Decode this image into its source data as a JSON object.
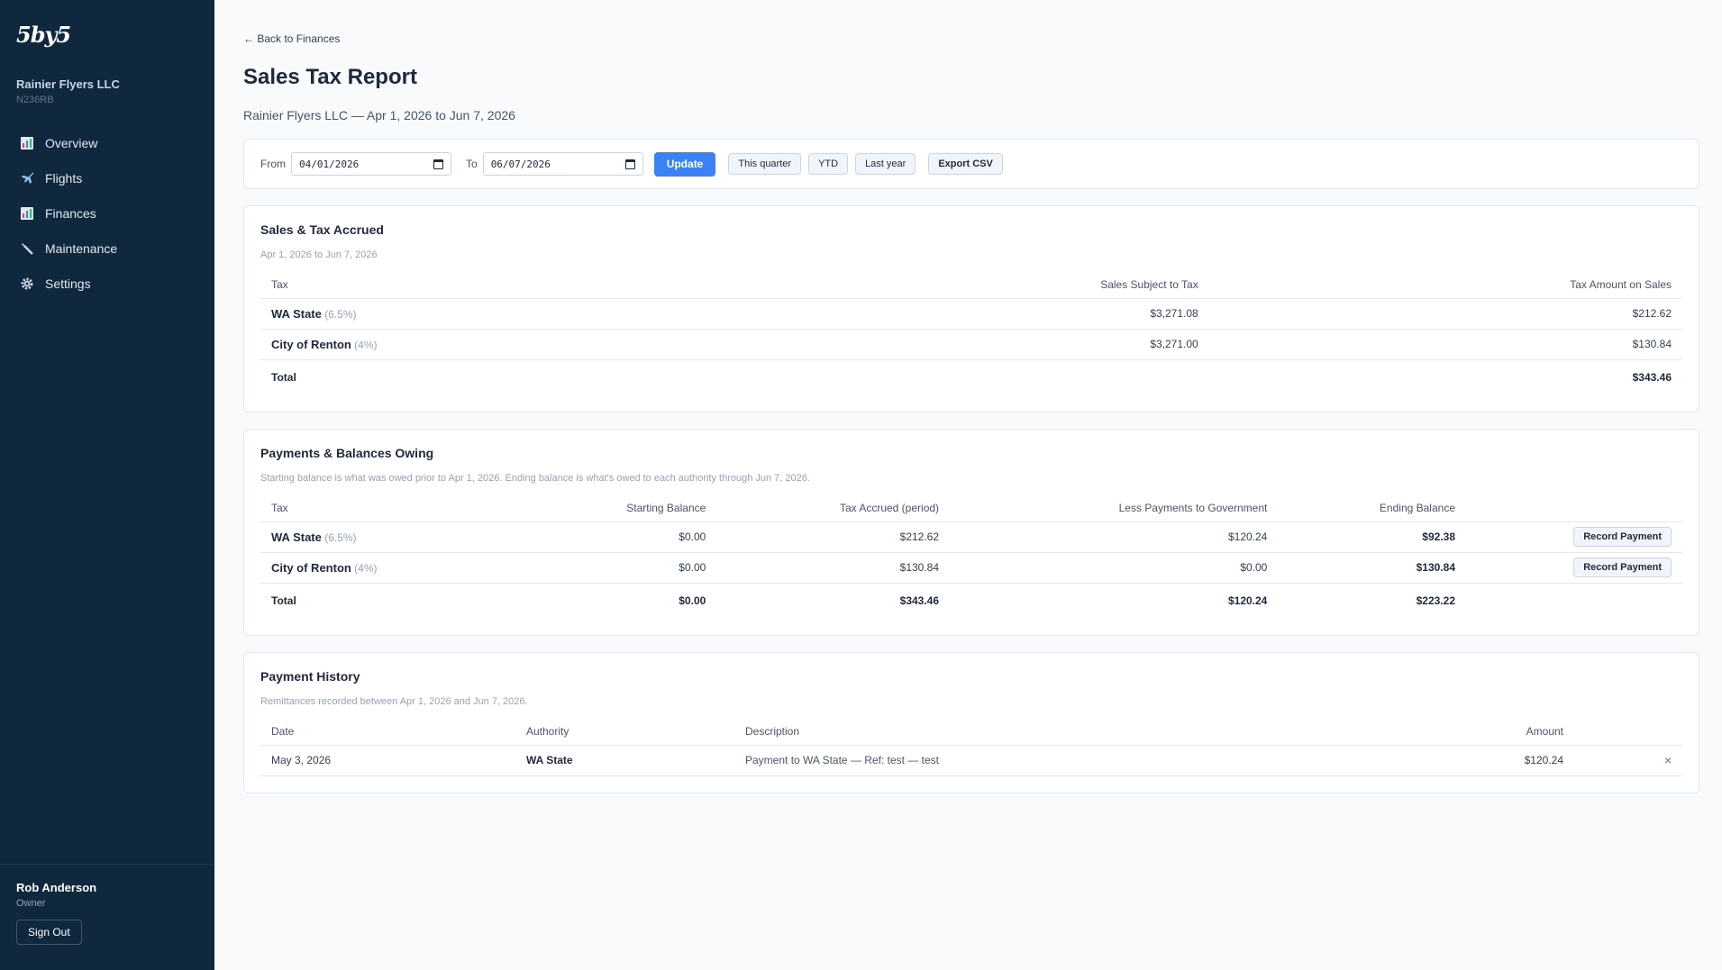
{
  "sidebar": {
    "logo": "5by5",
    "org_name": "Rainier Flyers LLC",
    "org_sub": "N236RB",
    "nav": [
      {
        "label": "Overview",
        "icon": "bar-chart-icon"
      },
      {
        "label": "Flights",
        "icon": "airplane-icon"
      },
      {
        "label": "Finances",
        "icon": "bar-chart-icon"
      },
      {
        "label": "Maintenance",
        "icon": "wrench-icon"
      },
      {
        "label": "Settings",
        "icon": "gear-icon"
      }
    ],
    "user_name": "Rob Anderson",
    "user_role": "Owner",
    "signout": "Sign Out"
  },
  "header": {
    "back": "← Back to Finances",
    "title": "Sales Tax Report",
    "subtitle": "Rainier Flyers LLC — Apr 1, 2026 to Jun 7, 2026"
  },
  "filter": {
    "from_label": "From",
    "from_value": "04/01/2026",
    "to_label": "To",
    "to_value": "06/07/2026",
    "update": "Update",
    "this_quarter": "This quarter",
    "ytd": "YTD",
    "last_year": "Last year",
    "export": "Export CSV"
  },
  "accrued": {
    "title": "Sales & Tax Accrued",
    "subtitle": "Apr 1, 2026 to Jun 7, 2026",
    "headers": [
      "Tax",
      "Sales Subject to Tax",
      "Tax Amount on Sales"
    ],
    "rows": [
      {
        "name": "WA State",
        "rate": "(6.5%)",
        "sales": "$3,271.08",
        "tax": "$212.62"
      },
      {
        "name": "City of Renton",
        "rate": "(4%)",
        "sales": "$3,271.00",
        "tax": "$130.84"
      }
    ],
    "total_label": "Total",
    "total_tax": "$343.46"
  },
  "payments": {
    "title": "Payments & Balances Owing",
    "subtitle": "Starting balance is what was owed prior to Apr 1, 2026. Ending balance is what's owed to each authority through Jun 7, 2026.",
    "headers": [
      "Tax",
      "Starting Balance",
      "Tax Accrued (period)",
      "Less Payments to Government",
      "Ending Balance"
    ],
    "record_label": "Record Payment",
    "rows": [
      {
        "name": "WA State",
        "rate": "(6.5%)",
        "start": "$0.00",
        "accrued": "$212.62",
        "paid": "$120.24",
        "ending": "$92.38"
      },
      {
        "name": "City of Renton",
        "rate": "(4%)",
        "start": "$0.00",
        "accrued": "$130.84",
        "paid": "$0.00",
        "ending": "$130.84"
      }
    ],
    "total_label": "Total",
    "total_start": "$0.00",
    "total_accrued": "$343.46",
    "total_paid": "$120.24",
    "total_ending": "$223.22"
  },
  "history": {
    "title": "Payment History",
    "subtitle": "Remittances recorded between Apr 1, 2026 and Jun 7, 2026.",
    "headers": [
      "Date",
      "Authority",
      "Description",
      "Amount"
    ],
    "rows": [
      {
        "date": "May 3, 2026",
        "authority": "WA State",
        "description": "Payment to WA State — Ref: test — test",
        "amount": "$120.24",
        "delete": "×"
      }
    ]
  }
}
